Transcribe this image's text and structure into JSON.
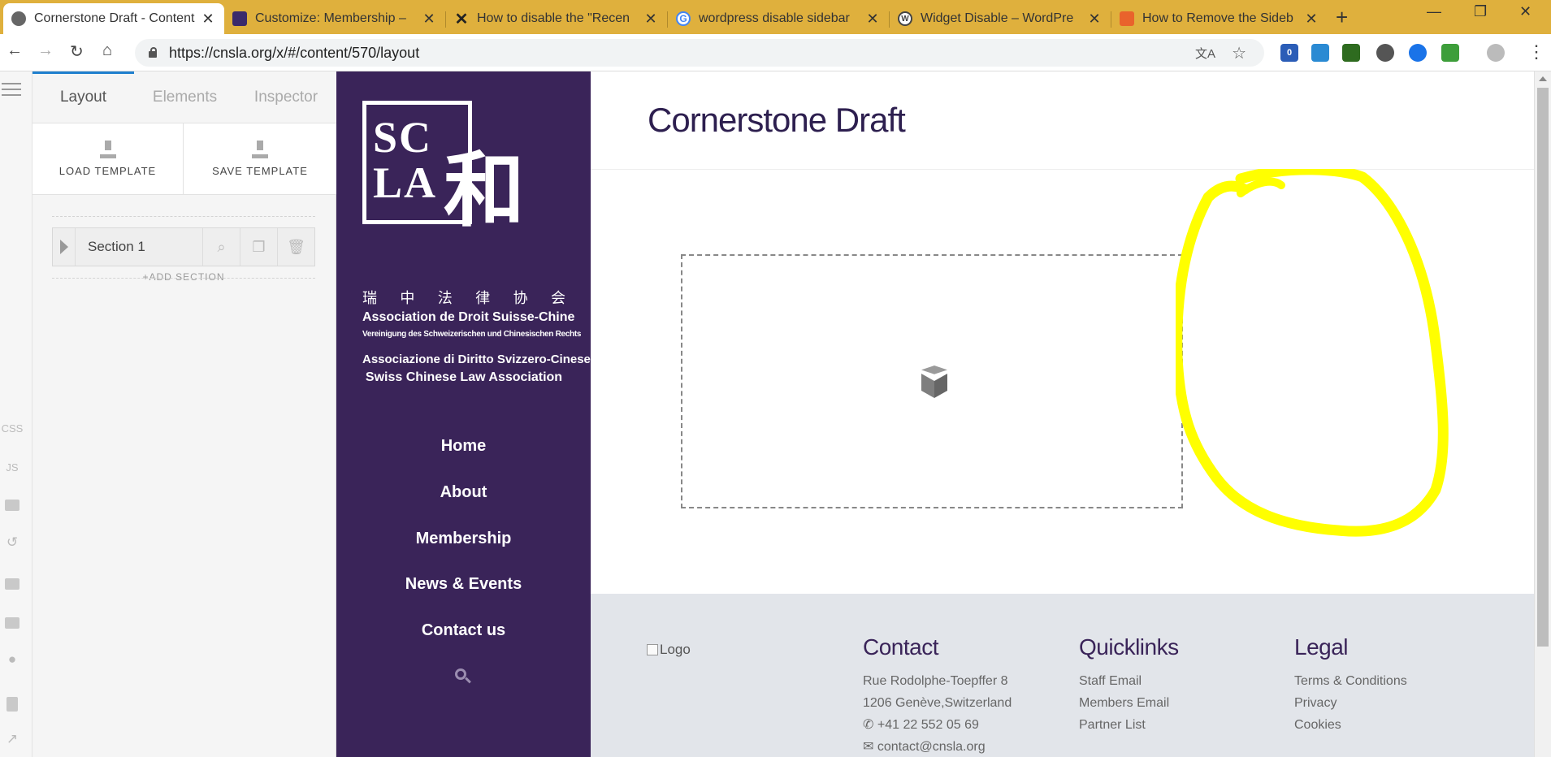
{
  "browser": {
    "tabs": [
      {
        "title": "Cornerstone Draft - Content",
        "favicon": "globe-icon",
        "active": true
      },
      {
        "title": "Customize: Membership –",
        "favicon": "site-icon"
      },
      {
        "title": "How to disable the \"Recen",
        "favicon": "x-icon"
      },
      {
        "title": "wordpress disable sidebar",
        "favicon": "google-icon"
      },
      {
        "title": "Widget Disable – WordPre",
        "favicon": "wordpress-icon"
      },
      {
        "title": "How to Remove the Sideb",
        "favicon": "site-orange-icon"
      }
    ],
    "url": "https://cnsla.org/x/#/content/570/layout",
    "extension_badge": "0"
  },
  "rail": {
    "css_label": "CSS",
    "js_label": "JS"
  },
  "builder": {
    "tabs": [
      "Layout",
      "Elements",
      "Inspector"
    ],
    "load_template": "LOAD TEMPLATE",
    "save_template": "SAVE TEMPLATE",
    "section_label": "Section 1",
    "add_section": "+ADD SECTION"
  },
  "site": {
    "logo_letters_top": "SC",
    "logo_letters_bottom": "LA",
    "logo_brush": "和",
    "org_chinese": [
      "瑞",
      "中",
      "法",
      "律",
      "协",
      "会"
    ],
    "org_french": "Association de Droit Suisse-Chine",
    "org_german": "Vereinigung des Schweizerischen und Chinesischen Rechts",
    "org_italian": "Associazione di Diritto Svizzero-Cinese",
    "org_english": "Swiss Chinese Law Association",
    "nav": [
      "Home",
      "About",
      "Membership",
      "News & Events",
      "Contact us"
    ]
  },
  "page": {
    "title": "Cornerstone Draft"
  },
  "footer": {
    "logo_alt": "Logo",
    "contact": {
      "heading": "Contact",
      "lines": [
        "Rue Rodolphe-Toepffer 8",
        "1206 Genève,Switzerland",
        "+41 22 552 05 69",
        "contact@cnsla.org"
      ]
    },
    "quicklinks": {
      "heading": "Quicklinks",
      "links": [
        "Staff Email",
        "Members Email",
        "Partner List"
      ]
    },
    "legal": {
      "heading": "Legal",
      "links": [
        "Terms & Conditions",
        "Privacy",
        "Cookies"
      ]
    }
  },
  "colors": {
    "tabstrip": "#dfb03d",
    "site_sidebar": "#3a2459",
    "title_color": "#2d1f4f",
    "highlight": "#ffff00"
  }
}
